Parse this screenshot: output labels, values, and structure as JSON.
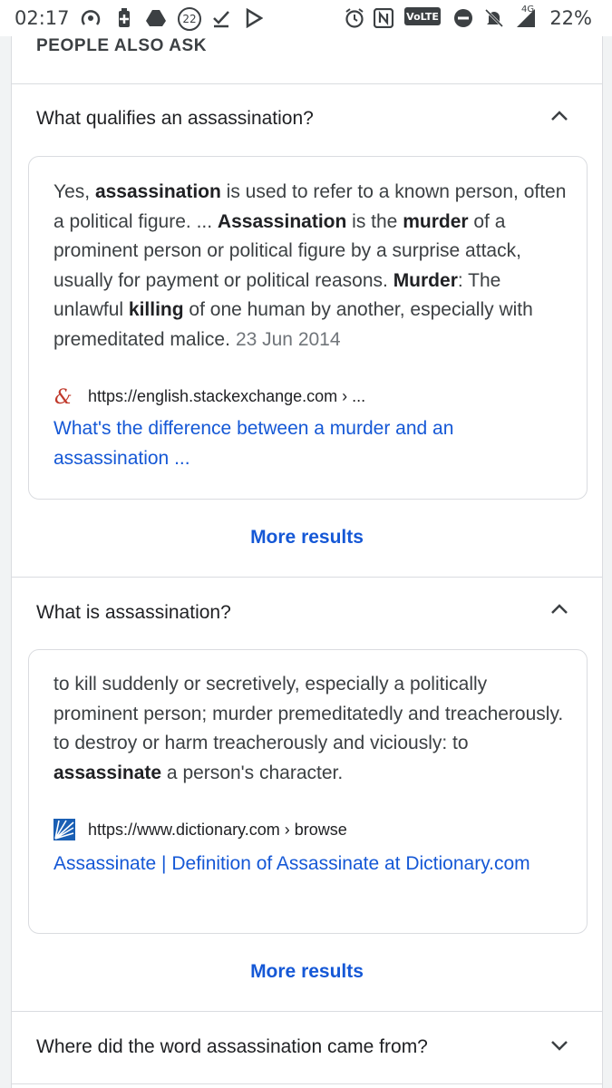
{
  "status_bar": {
    "time": "02:17",
    "notif_count": "22",
    "network": "4G",
    "battery": "22%"
  },
  "section_title": "PEOPLE ALSO ASK",
  "questions": [
    {
      "question": "What qualifies an assassination?",
      "expanded": true,
      "date": "23 Jun 2014",
      "source_url": "https://english.stackexchange.com › ...",
      "link_title": "What's the difference between a murder and an assassination ...",
      "more": "More results"
    },
    {
      "question": "What is assassination?",
      "expanded": true,
      "source_url": "https://www.dictionary.com › browse",
      "link_title": "Assassinate | Definition of Assassinate at Dictionary.com",
      "more": "More results"
    },
    {
      "question": "Where did the word assassination came from?",
      "expanded": false
    }
  ],
  "answer1": {
    "p1": "Yes, ",
    "b1": "assassination",
    "p2": " is used to refer to a known person, often a political figure. ... ",
    "b2": "Assassination",
    "p3": " is the ",
    "b3": "murder",
    "p4": " of a prominent person or political figure by a surprise attack, usually for payment or political reasons. ",
    "b4": "Murder",
    "p5": ": The unlawful ",
    "b5": "killing",
    "p6": " of one human by another, especially with premeditated malice."
  },
  "answer2": {
    "p1": "to kill suddenly or secretively, especially a politically prominent person; murder premeditatedly and treacherously. to destroy or harm treacherously and viciously: to ",
    "b1": "assassinate",
    "p2": " a person's character."
  },
  "colors": {
    "link": "#1558d6",
    "text": "#202124",
    "divider": "#dadce0",
    "stackexchange_icon": "#c0392b",
    "dictionary_icon": "#1a5fb4"
  }
}
